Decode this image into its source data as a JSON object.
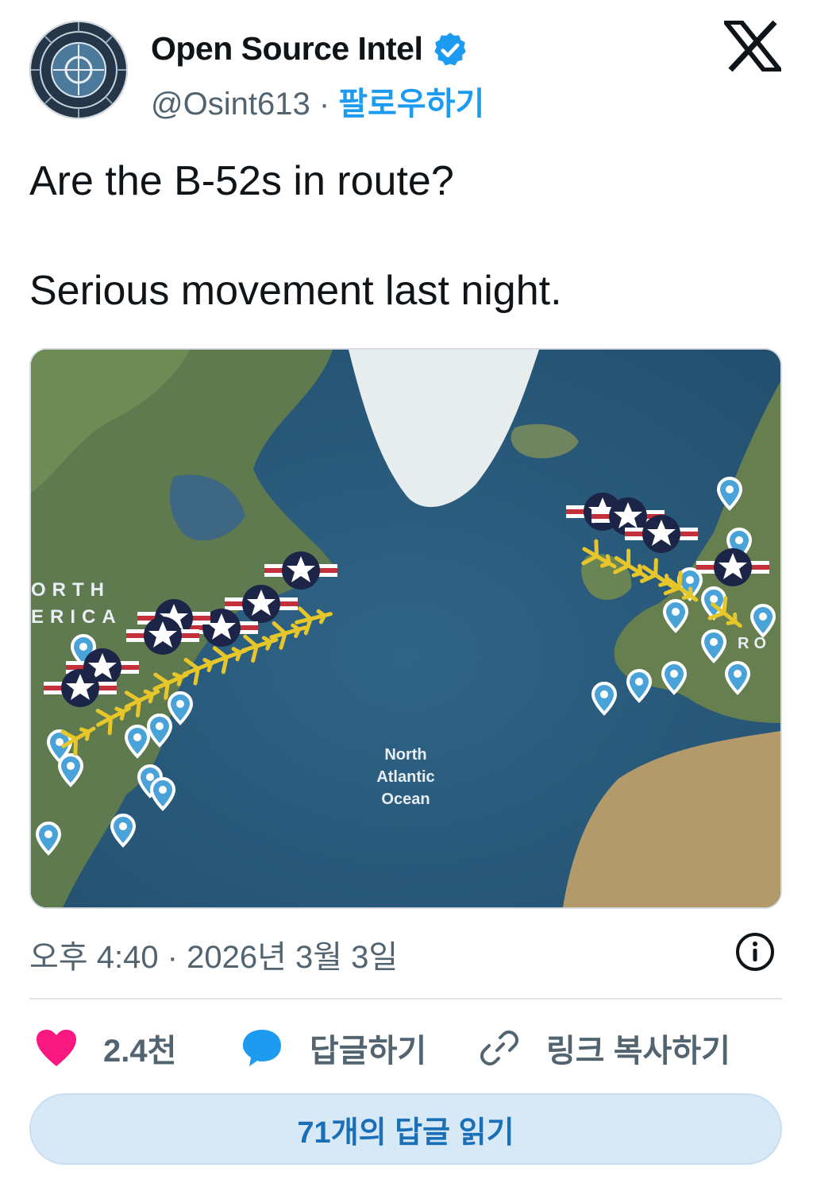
{
  "author": {
    "name": "Open Source Intel",
    "handle": "@Osint613",
    "separator": " · ",
    "follow_label": "팔로우하기",
    "verified": true
  },
  "tweet": {
    "line1": "Are the B-52s in route?",
    "line2": "Serious movement last night."
  },
  "media": {
    "ocean_label_1": "North",
    "ocean_label_2": "Atlantic",
    "ocean_label_3": "Ocean",
    "continent_label_1": "ORTH",
    "continent_label_2": "ERICA",
    "europe_label": "RO"
  },
  "timestamp": "오후 4:40 · 2026년 3월 3일",
  "actions": {
    "like_count": "2.4천",
    "reply_label": "답글하기",
    "copy_link_label": "링크 복사하기"
  },
  "read_replies_label": "71개의 답글 읽기",
  "colors": {
    "accent": "#1d9bf0",
    "like": "#f91880",
    "reply_icon": "#1d9bf0",
    "text_secondary": "#536471"
  },
  "icons": [
    "x-logo-icon",
    "verified-badge-icon",
    "heart-icon",
    "reply-bubble-icon",
    "link-icon",
    "info-icon"
  ]
}
